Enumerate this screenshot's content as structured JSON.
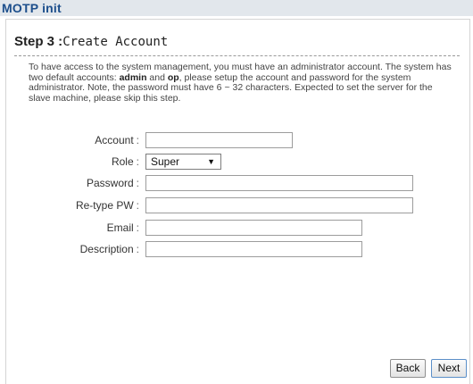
{
  "app": {
    "title": "MOTP init"
  },
  "step": {
    "number_label": "Step 3 :",
    "title": "Create Account"
  },
  "intro": {
    "part1": "To have access to the system management, you must have an administrator account. The system has two default accounts: ",
    "admin": "admin",
    "and": " and ",
    "op": "op",
    "part2": ", please setup the account and password for the system administrator. Note, the password must have 6 ~ 32 characters. Expected to set the server for the slave machine, please skip this step."
  },
  "form": {
    "account": {
      "label": "Account",
      "value": ""
    },
    "role": {
      "label": "Role",
      "value": "Super"
    },
    "password": {
      "label": "Password",
      "value": ""
    },
    "retype": {
      "label": "Re-type PW",
      "value": ""
    },
    "email": {
      "label": "Email",
      "value": ""
    },
    "description": {
      "label": "Description",
      "value": ""
    },
    "colon": ":"
  },
  "buttons": {
    "back": "Back",
    "next": "Next"
  }
}
